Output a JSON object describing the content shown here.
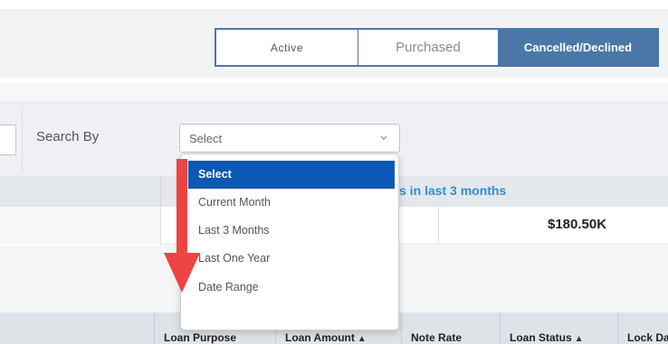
{
  "tabs": {
    "items": [
      {
        "label": "Active",
        "state": "inactive"
      },
      {
        "label": "Purchased",
        "state": "inactive"
      },
      {
        "label": "Cancelled/Declined",
        "state": "selected"
      }
    ],
    "accent_color": "#4a77a8"
  },
  "search": {
    "label": "Search By",
    "selected_value": "Select",
    "options": [
      "Select",
      "Current Month",
      "Last 3 Months",
      "Last One Year",
      "Date Range"
    ],
    "highlighted_option": "Select",
    "highlight_color": "#0b58b5"
  },
  "summary": {
    "header_link_text": "s in last 3 months",
    "header_link_color": "#2f8fd8",
    "amount": "$180.50K"
  },
  "table": {
    "columns": [
      {
        "label": "Loan Purpose",
        "sortable": false
      },
      {
        "label": "Loan Amount",
        "sortable": true
      },
      {
        "label": "Note Rate",
        "sortable": false
      },
      {
        "label": "Loan Status",
        "sortable": true
      },
      {
        "label": "Lock Da",
        "sortable": false
      }
    ]
  },
  "annotation": {
    "arrow_color": "#ee4444",
    "icon": "down-arrow-icon"
  }
}
